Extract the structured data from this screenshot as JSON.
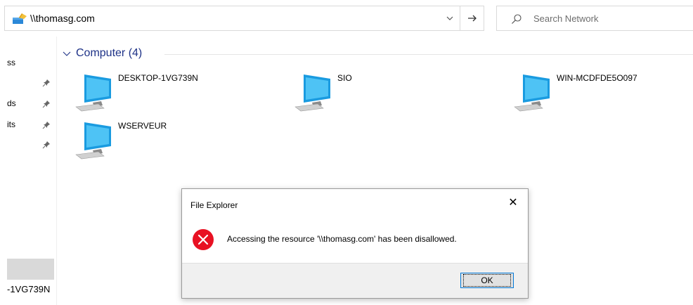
{
  "address_bar": {
    "path": "\\\\thomasg.com",
    "icon": "network-drive-icon",
    "dropdown_icon": "chevron-down-icon",
    "go_icon": "arrow-right-icon"
  },
  "search": {
    "placeholder": "Search Network",
    "icon": "search-icon"
  },
  "nav": {
    "items": [
      {
        "label": "ss",
        "pinned": false
      },
      {
        "label": "ds",
        "pinned": true
      },
      {
        "label": "its",
        "pinned": true
      }
    ],
    "bottom_label": "-1VG739N"
  },
  "group": {
    "title": "Computer (4)"
  },
  "computers": [
    {
      "name": "DESKTOP-1VG739N"
    },
    {
      "name": "SIO"
    },
    {
      "name": "WIN-MCDFDE5O097"
    },
    {
      "name": "WSERVEUR"
    }
  ],
  "dialog": {
    "title": "File Explorer",
    "close_label": "✕",
    "message": "Accessing the resource '\\\\thomasg.com' has been disallowed.",
    "ok_label": "OK",
    "error_color": "#e81123"
  },
  "colors": {
    "group_header": "#1e3287",
    "ok_focus_border": "#0078d7"
  }
}
